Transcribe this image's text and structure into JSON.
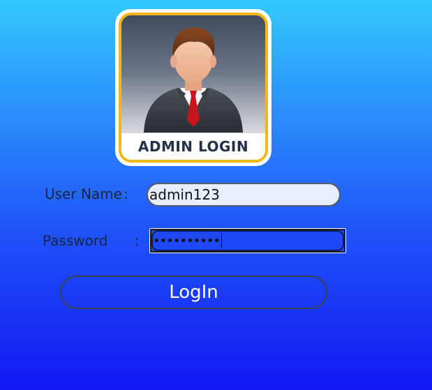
{
  "logo": {
    "caption": "ADMIN LOGIN",
    "icon": "admin-user-icon",
    "border_color": "#f5b61a",
    "caption_color": "#22304a"
  },
  "form": {
    "username": {
      "label": "User Name",
      "colon": ":",
      "value": "admin123"
    },
    "password": {
      "label": "Password",
      "colon": ":",
      "masked_value": "••••••••••"
    },
    "login_button": {
      "label": "LogIn"
    }
  },
  "colors": {
    "background_top": "#33c8fc",
    "background_bottom": "#1218f2",
    "label_text": "#1a2540"
  }
}
